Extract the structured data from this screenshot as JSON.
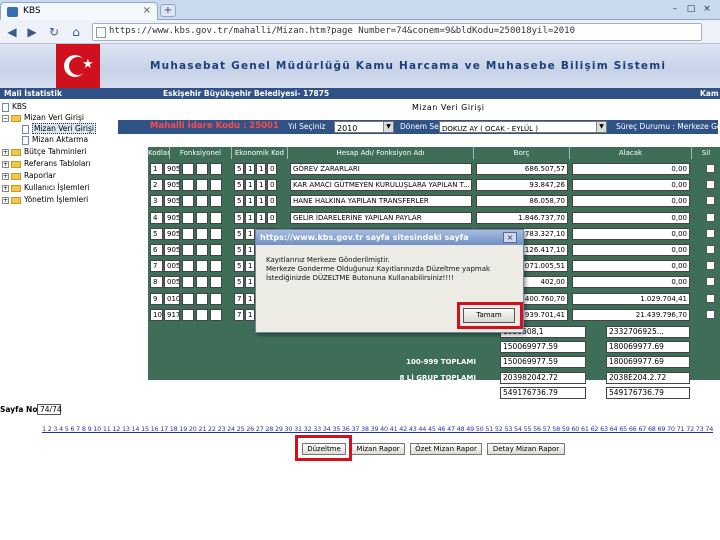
{
  "browser": {
    "tab_title": "KBS",
    "tab_close": "×",
    "new_tab": "+",
    "url": "https://www.kbs.gov.tr/mahalli/Mizan.htm?page Number=74&conem=9&bldKodu=250018yil=2010"
  },
  "banner": {
    "title": "Muhasebat Genel Müdürlüğü Kamu Harcama ve Muhasebe Bilişim Sistemi"
  },
  "strip": {
    "left": "Mali İstatistik",
    "center": "Eskişehir Büyükşehir Belediyesi- 17875",
    "right": "Kam"
  },
  "tree": {
    "root": "KBS",
    "items": [
      {
        "label": "Mizan Veri Girişi"
      },
      {
        "label": "Mizan Veri Girişi"
      },
      {
        "label": "Mizan Aktarma"
      },
      {
        "label": "Bütçe Tahminleri"
      },
      {
        "label": "Referans Tabloları"
      },
      {
        "label": "Raporlar"
      },
      {
        "label": "Kullanıcı İşlemleri"
      },
      {
        "label": "Yönetim İşlemleri"
      }
    ]
  },
  "page_heading": "Mizan Veri Girişi",
  "filter": {
    "admin_code": "Mahalli İdare Kodu : 25001",
    "year_label": "Yıl Seçiniz",
    "year_value": "2010",
    "period_label": "Dönem Seçiniz",
    "period_value": "DOKUZ AY ( OCAK - EYLÜL )",
    "status_label": "Süreç Durumu : Merkeze Gönde"
  },
  "table": {
    "headers": [
      "Kodlar",
      "Fonksiyonel",
      "Ekonomik Kod",
      "Hesap Adı/ Fonksiyon Adı",
      "Borç",
      "Alacak",
      "Sil"
    ],
    "rows": [
      {
        "a": "1",
        "b": "905",
        "e1": "5",
        "e2": "1",
        "e3": "1",
        "e4": "0",
        "name": "GÖREV ZARARLARI",
        "borc": "686.507,57",
        "alacak": "0,00"
      },
      {
        "a": "2",
        "b": "905",
        "e1": "5",
        "e2": "1",
        "e3": "1",
        "e4": "0",
        "name": "KAR AMACI GÜTMEYEN KURULUŞLARA YAPILAN T...",
        "borc": "93.847,26",
        "alacak": "0,00"
      },
      {
        "a": "3",
        "b": "905",
        "e1": "5",
        "e2": "1",
        "e3": "1",
        "e4": "0",
        "name": "HANE HALKINA YAPILAN TRANSFERLER",
        "borc": "86.058,70",
        "alacak": "0,00"
      },
      {
        "a": "4",
        "b": "905",
        "e1": "5",
        "e2": "1",
        "e3": "1",
        "e4": "0",
        "name": "GELİR İDARELERİNE YAPILAN PAYLAR",
        "borc": "1.846.737,70",
        "alacak": "0,00"
      },
      {
        "a": "5",
        "b": "905",
        "e1": "5",
        "e2": "1",
        "e3": "1",
        "e4": "0",
        "name": "",
        "borc": "783.327,10",
        "alacak": "0,00"
      },
      {
        "a": "6",
        "b": "905",
        "e1": "5",
        "e2": "1",
        "e3": "",
        "e4": "",
        "name": "",
        "borc": "1.126.417,10",
        "alacak": "0,00"
      },
      {
        "a": "7",
        "b": "005",
        "e1": "5",
        "e2": "1",
        "e3": "",
        "e4": "",
        "name": "",
        "borc": "21.071.005,51",
        "alacak": "0,00"
      },
      {
        "a": "8",
        "b": "005",
        "e1": "5",
        "e2": "1",
        "e3": "",
        "e4": "",
        "name": "",
        "borc": "402,00",
        "alacak": "0,00"
      },
      {
        "a": "9",
        "b": "010",
        "e1": "7",
        "e2": "1",
        "e3": "",
        "e4": "",
        "name": "",
        "borc": "21.400.760,70",
        "alacak": "1.029.704,41"
      },
      {
        "a": "10",
        "b": "917",
        "e1": "7",
        "e2": "1",
        "e3": "",
        "e4": "",
        "name": "",
        "borc": "1.939.701,41",
        "alacak": "21.439.796,70"
      }
    ],
    "totals": [
      {
        "label": "",
        "borc": "1939508,1",
        "alacak": "2332706925..."
      },
      {
        "label": "",
        "borc": "150069977.59",
        "alacak": "180069977.69"
      },
      {
        "label": "100-999 TOPLAMI",
        "borc": "150069977.59",
        "alacak": "180069977.69"
      },
      {
        "label": "8 Lİ GRUP TOPLAMI",
        "borc": "203982042.72",
        "alacak": "2038E204.2.72"
      },
      {
        "label": "9 LU GRUP TOPLAMI",
        "borc": "549176736.79",
        "alacak": "549176736.79"
      }
    ]
  },
  "dialog": {
    "title": "https://www.kbs.gov.tr sayfa sitesindeki sayfa",
    "close": "×",
    "message_lines": [
      "Kayıtlarınız Merkeze Gönderilmiştir.",
      "Merkeze Gonderme Olduğunuz Kayıtlarınızda Düzeltme yapmak",
      "İstediğinizde DÜZELTME Butonuna Kullanabilirsiniz!!!!"
    ],
    "ok": "Tamam"
  },
  "pagination": {
    "label": "Sayfa No",
    "current": "74/74",
    "links": "1 2 3 4 5 6 7 8 9 10 11 12 13 14 15 16 17 18 19 20 21 22 23 24 25 26 27 28 29 30 31 32 33 34 35 36 37 38 39 40 41 42 43 44 45 46 47 48 49 50 51 52 53 54 55 56 57 58 59 60 61 62 63 64 65 66 67 68 69 70 71 72 73 74"
  },
  "actions": {
    "duzeltme": "Düzeltme",
    "mizan_rapor": "Mizan Rapor",
    "ozet_mizan_rapor": "Özet Mizan Rapor",
    "detay_mizan_rapor": "Detay Mizan Rapor"
  },
  "colors": {
    "banner_title": "#1f3f7a",
    "header_strip": "#2f5386",
    "grid_background": "#3f6e58",
    "highlight": "#d3101c"
  }
}
